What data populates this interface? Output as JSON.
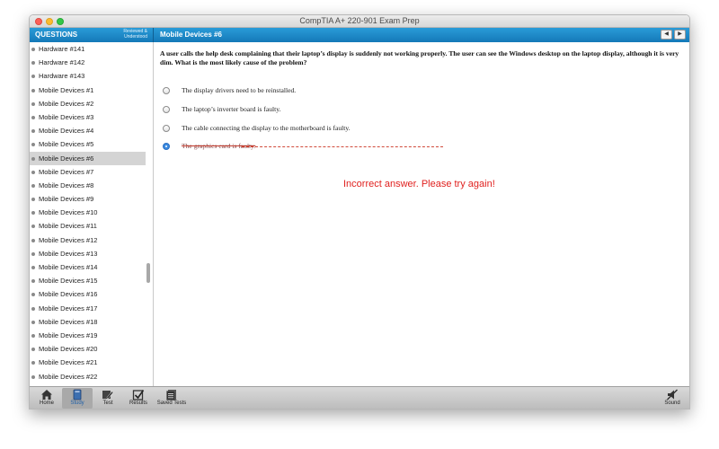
{
  "window": {
    "title": "CompTIA A+ 220-901 Exam Prep"
  },
  "sidebar": {
    "title": "QUESTIONS",
    "subtitle_line1": "Reviewed &",
    "subtitle_line2": "Understood",
    "items": [
      {
        "label": "Hardware #141"
      },
      {
        "label": "Hardware #142"
      },
      {
        "label": "Hardware #143"
      },
      {
        "label": "Mobile Devices #1"
      },
      {
        "label": "Mobile Devices #2"
      },
      {
        "label": "Mobile Devices #3"
      },
      {
        "label": "Mobile Devices #4"
      },
      {
        "label": "Mobile Devices #5"
      },
      {
        "label": "Mobile Devices #6",
        "selected": true
      },
      {
        "label": "Mobile Devices #7"
      },
      {
        "label": "Mobile Devices #8"
      },
      {
        "label": "Mobile Devices #9"
      },
      {
        "label": "Mobile Devices #10"
      },
      {
        "label": "Mobile Devices #11"
      },
      {
        "label": "Mobile Devices #12"
      },
      {
        "label": "Mobile Devices #13"
      },
      {
        "label": "Mobile Devices #14"
      },
      {
        "label": "Mobile Devices #15"
      },
      {
        "label": "Mobile Devices #16"
      },
      {
        "label": "Mobile Devices #17"
      },
      {
        "label": "Mobile Devices #18"
      },
      {
        "label": "Mobile Devices #19"
      },
      {
        "label": "Mobile Devices #20"
      },
      {
        "label": "Mobile Devices #21"
      },
      {
        "label": "Mobile Devices #22"
      }
    ]
  },
  "content": {
    "title": "Mobile Devices #6",
    "nav_prev_icon": "triangle-left-icon",
    "nav_next_icon": "triangle-right-icon",
    "question": "A user calls the help desk complaining that their laptop’s display is suddenly not working properly. The user can see the Windows desktop on the laptop display, although it is very dim. What is the most likely cause of the problem?",
    "options": [
      {
        "text": "The display drivers need to be reinstalled.",
        "selected": false
      },
      {
        "text": "The laptop’s inverter board is faulty.",
        "selected": false
      },
      {
        "text": "The cable connecting the display to the motherboard is faulty.",
        "selected": false
      },
      {
        "text": "The graphics card is faulty.",
        "selected": true,
        "marked_wrong": true
      }
    ],
    "feedback": "Incorrect answer. Please try again!",
    "feedback_color": "#e0211f"
  },
  "toolbar": {
    "items": [
      {
        "label": "Home",
        "icon": "home-icon"
      },
      {
        "label": "Study",
        "icon": "study-book-icon",
        "active": true
      },
      {
        "label": "Test",
        "icon": "test-pencil-icon"
      },
      {
        "label": "Results",
        "icon": "results-check-icon"
      },
      {
        "label": "Saved Tests",
        "icon": "saved-tests-icon"
      },
      {
        "label": "Sound",
        "icon": "sound-muted-icon"
      }
    ]
  },
  "colors": {
    "accent": "#1f8acb",
    "selected_row": "#d4d4d4",
    "error": "#e0211f"
  }
}
